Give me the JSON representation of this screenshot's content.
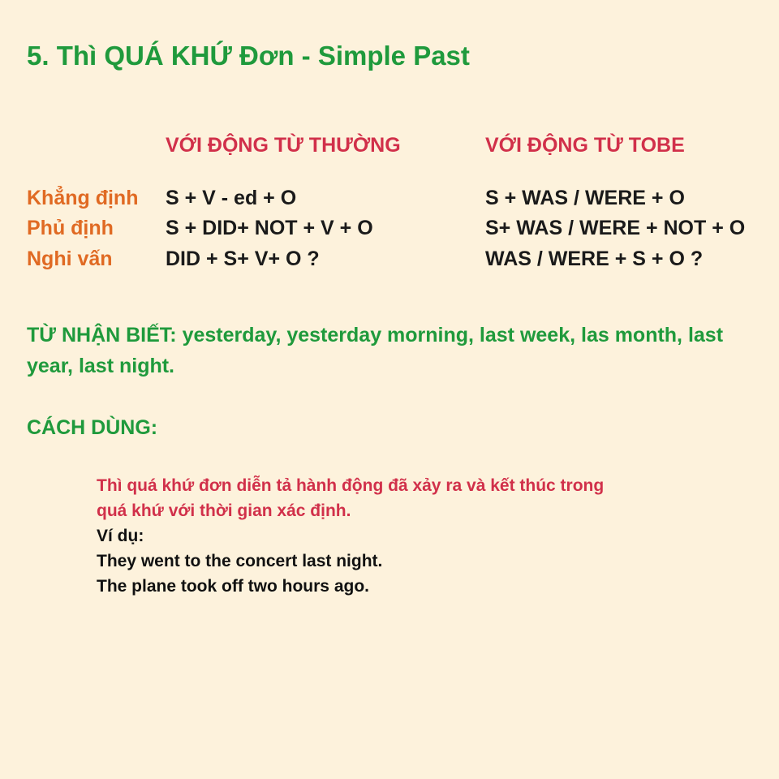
{
  "title": "5. Thì QUÁ KHỨ Đơn - Simple Past",
  "table": {
    "columns": [
      "VỚI ĐỘNG TỪ THƯỜNG",
      "VỚI ĐỘNG TỪ TOBE"
    ],
    "rows": [
      {
        "label": "Khẳng định",
        "regular": "S + V - ed + O",
        "tobe": "S + WAS / WERE + O"
      },
      {
        "label": "Phủ định",
        "regular": "S + DID+ NOT + V + O",
        "tobe": "S+ WAS / WERE + NOT + O"
      },
      {
        "label": "Nghi vấn",
        "regular": "DID + S+ V+ O ?",
        "tobe": "WAS / WERE + S + O ?"
      }
    ]
  },
  "signal_words": "TỪ NHẬN BIẾT: yesterday, yesterday morning, last week, las month, last year, last night.",
  "usage": {
    "heading": "CÁCH DÙNG:",
    "description_lines": [
      "Thì quá khứ đơn diễn tả hành động đã xảy ra và kết thúc trong",
      "quá khứ với thời gian xác định."
    ],
    "example_label": "Ví dụ:",
    "examples": [
      "They went to the concert last night.",
      "The plane took off two hours ago."
    ]
  },
  "colors": {
    "background": "#fdf2dc",
    "title_green": "#1f9a3c",
    "heading_red": "#d1304a",
    "label_orange": "#e06a23",
    "text_black": "#1a1a1a"
  }
}
